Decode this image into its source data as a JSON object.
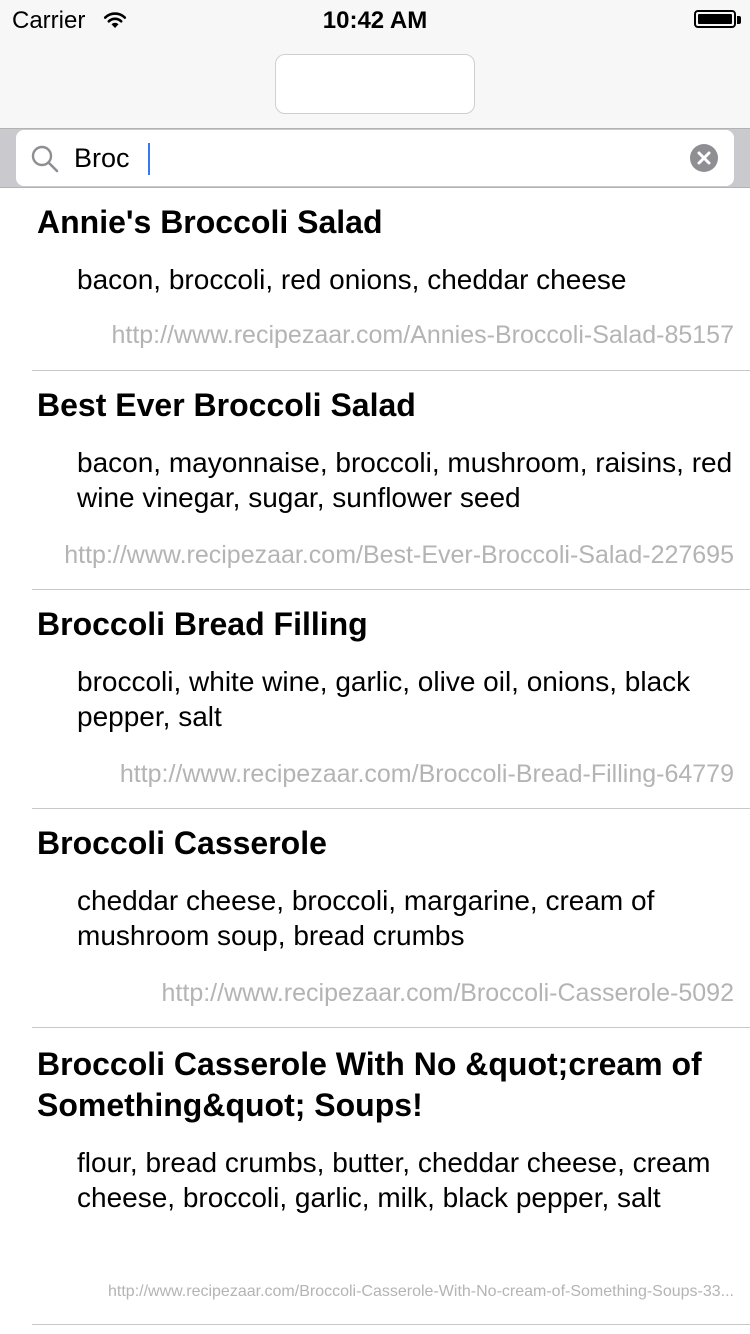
{
  "status_bar": {
    "carrier": "Carrier",
    "time": "10:42 AM",
    "wifi_icon": "wifi-icon",
    "battery_icon": "battery-icon"
  },
  "nav_bar": {
    "title": ""
  },
  "search": {
    "value": "Broc",
    "placeholder": "",
    "search_icon": "magnifying-glass-icon",
    "clear_icon": "clear-x-icon"
  },
  "results": [
    {
      "title": "Annie's Broccoli Salad",
      "ingredients": "bacon, broccoli, red onions, cheddar cheese",
      "url": "http://www.recipezaar.com/Annies-Broccoli-Salad-85157"
    },
    {
      "title": "Best Ever Broccoli Salad",
      "ingredients": "bacon, mayonnaise, broccoli, mushroom, raisins, red wine vinegar, sugar, sunflower seed",
      "url": "http://www.recipezaar.com/Best-Ever-Broccoli-Salad-227695"
    },
    {
      "title": "Broccoli Bread Filling",
      "ingredients": "broccoli, white wine, garlic, olive oil, onions, black pepper, salt",
      "url": "http://www.recipezaar.com/Broccoli-Bread-Filling-64779"
    },
    {
      "title": "Broccoli Casserole",
      "ingredients": "cheddar cheese, broccoli, margarine, cream of mushroom soup, bread crumbs",
      "url": "http://www.recipezaar.com/Broccoli-Casserole-5092"
    },
    {
      "title": "Broccoli Casserole With No &quot;cream of Something&quot; Soups!",
      "ingredients": "flour, bread crumbs, butter, cheddar cheese, cream cheese, broccoli, garlic, milk, black pepper, salt",
      "url": "http://www.recipezaar.com/Broccoli-Casserole-With-No-cream-of-Something-Soups-33..."
    }
  ],
  "colors": {
    "url_text": "#b4b4b4",
    "caret": "#3478f6",
    "bar_background": "#f7f7f7",
    "search_background": "#c9c9ce"
  }
}
